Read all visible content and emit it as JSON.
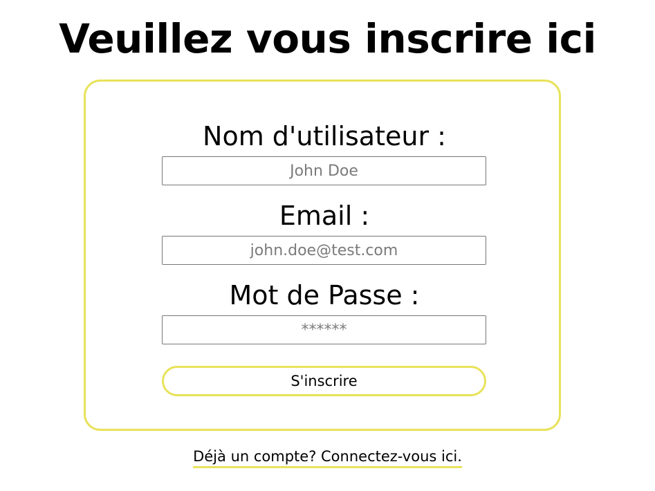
{
  "page": {
    "title": "Veuillez vous inscrire ici"
  },
  "form": {
    "username": {
      "label": "Nom d'utilisateur :",
      "value": "",
      "placeholder": "John Doe"
    },
    "email": {
      "label": "Email :",
      "value": "",
      "placeholder": "john.doe@test.com"
    },
    "password": {
      "label": "Mot de Passe :",
      "value": "",
      "placeholder": "******"
    },
    "submit_label": "S'inscrire"
  },
  "footer": {
    "login_link": "Déjà un compte? Connectez-vous ici."
  },
  "colors": {
    "accent": "#e8e25a",
    "input_border": "#767676",
    "placeholder_text": "#7a7a7a"
  }
}
